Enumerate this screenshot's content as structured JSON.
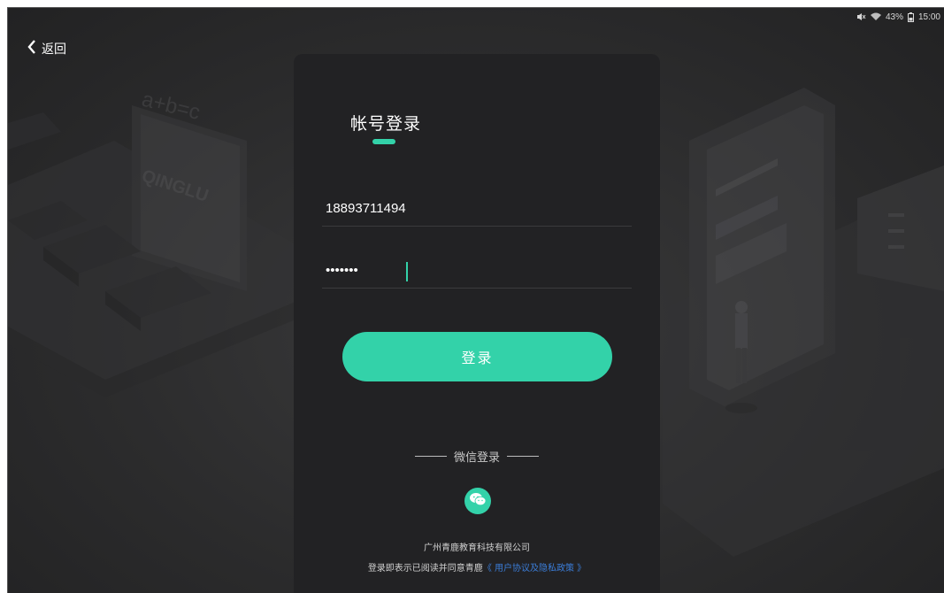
{
  "status_bar": {
    "battery": "43%",
    "time": "15:00"
  },
  "nav": {
    "back_label": "返回"
  },
  "illustration": {
    "equation_text": "a+b=c",
    "logo_text": "QINGLU"
  },
  "login": {
    "title": "帐号登录",
    "account_value": "18893711494",
    "password_value": "•••••••",
    "login_button": "登录",
    "wechat_divider": "微信登录",
    "company": "广州青鹿教育科技有限公司",
    "agreement_prefix": "登录即表示已阅读并同意青鹿",
    "agreement_link": "《 用户协议及隐私政策 》"
  },
  "colors": {
    "accent": "#33d2a9",
    "card_bg": "#222224",
    "link": "#3b7dd8"
  }
}
